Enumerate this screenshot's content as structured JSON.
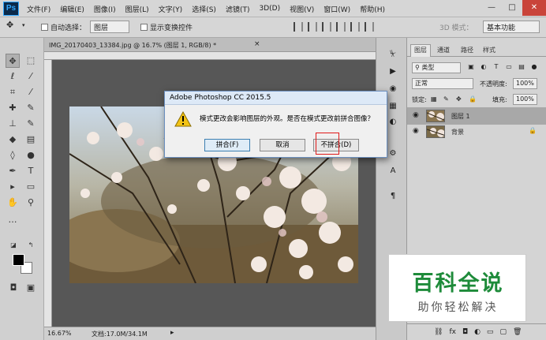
{
  "app": {
    "logo": "Ps",
    "menu": [
      "文件(F)",
      "编辑(E)",
      "图像(I)",
      "图层(L)",
      "文字(Y)",
      "选择(S)",
      "滤镜(T)",
      "3D(D)",
      "视图(V)",
      "窗口(W)",
      "帮助(H)"
    ],
    "window_buttons": [
      "—",
      "□",
      "✕"
    ]
  },
  "options_bar": {
    "auto_select_label": "自动选择：",
    "auto_select_value": "图层",
    "show_transform_label": "显示变换控件",
    "mode_3d_label": "3D 模式：",
    "workspace": "基本功能"
  },
  "document": {
    "tab_title": "IMG_20170403_13384.jpg @ 16.7% (图层 1, RGB/8) *",
    "tab_close": "×",
    "zoom": "16.67%",
    "doc_info": "文档:17.0M/34.1M",
    "status_arrow": "▸"
  },
  "dialog": {
    "title": "Adobe Photoshop CC 2015.5",
    "message": "模式更改会影响图层的外观。是否在模式更改前拼合图像？",
    "buttons": {
      "flatten": "拼合(F)",
      "cancel": "取消",
      "dont_flatten": "不拼合(D)"
    }
  },
  "layers_panel": {
    "tabs": [
      "图层",
      "通道",
      "路径",
      "样式"
    ],
    "filter": "类型",
    "blend_mode": "正常",
    "opacity_label": "不透明度:",
    "opacity_value": "100%",
    "lock_label": "锁定:",
    "fill_label": "填充:",
    "fill_value": "100%",
    "layers": [
      {
        "name": "图层 1"
      },
      {
        "name": "背景"
      }
    ],
    "bottom_icons": [
      "⛓",
      "fx",
      "◘",
      "◐",
      "▭",
      "▢",
      "🗑"
    ]
  },
  "watermark": {
    "title": "百科全说",
    "subtitle": "助你轻松解决"
  },
  "colors": {
    "accent": "#31a8ff",
    "watermark_green": "#1e8b3a",
    "highlight_red": "#e01a1a"
  }
}
